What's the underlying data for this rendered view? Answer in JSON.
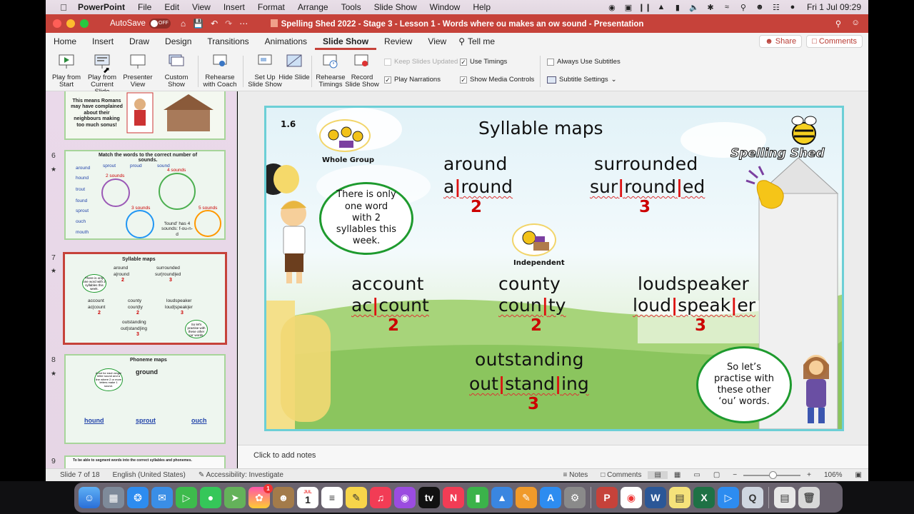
{
  "menubar": {
    "app": "PowerPoint",
    "items": [
      "File",
      "Edit",
      "View",
      "Insert",
      "Format",
      "Arrange",
      "Tools",
      "Slide Show",
      "Window",
      "Help"
    ],
    "clock": "Fri 1 Jul  09:29"
  },
  "titlebar": {
    "autosave_label": "AutoSave",
    "autosave_state": "OFF",
    "title": "Spelling Shed 2022 - Stage 3 - Lesson 1 - Words where ou makes an ow sound - Presentation"
  },
  "ribbon_tabs": {
    "tabs": [
      "Home",
      "Insert",
      "Draw",
      "Design",
      "Transitions",
      "Animations",
      "Slide Show",
      "Review",
      "View"
    ],
    "tell_me": "Tell me",
    "share": "Share",
    "comments": "Comments"
  },
  "ribbon": {
    "play_from_start": "Play from Start",
    "play_from_current": "Play from Current Slide",
    "presenter_view": "Presenter View",
    "custom_show": "Custom Show",
    "rehearse_coach": "Rehearse with Coach",
    "set_up": "Set Up Slide Show",
    "hide_slide": "Hide Slide",
    "rehearse_timings": "Rehearse Timings",
    "record": "Record Slide Show",
    "keep_updated": "Keep Slides Updated",
    "play_narrations": "Play Narrations",
    "use_timings": "Use Timings",
    "show_media": "Show Media Controls",
    "always_subtitles": "Always Use Subtitles",
    "subtitle_settings": "Subtitle Settings"
  },
  "thumbnails": {
    "top_partial_text": "This means Romans may have complained about their neighbours making too much sonus!",
    "slides": [
      {
        "num": "6",
        "title": "Match the words to the correct number of sounds.",
        "words": [
          "around",
          "sprout",
          "proud",
          "sound",
          "hound",
          "trout",
          "found",
          "sprout",
          "ouch",
          "mouth"
        ],
        "note": "'found' has 4 sounds: f-ou-n-d",
        "circles": [
          "2 sounds",
          "4 sounds",
          "3 sounds",
          "5 sounds"
        ]
      },
      {
        "num": "7",
        "title": "Syllable maps",
        "bubble": "There is only one word with 2 syllables this week.",
        "bubble2": "So let's practise with these other 'ou' words."
      },
      {
        "num": "8",
        "title": "Phoneme maps",
        "word_top": "ground",
        "words": [
          "hound",
          "sprout",
          "ouch"
        ],
        "bubble": "A dot for each single letter sound and a line where 2 or more letters make 1 sound."
      },
      {
        "num": "9",
        "title": "To be able to segment words into the correct syllables and phonemes."
      }
    ]
  },
  "slide": {
    "number": "1.6",
    "title": "Syllable maps",
    "brand": "Spelling Shed",
    "whole_group": "Whole Group",
    "independent": "Independent",
    "bubble_left": "There is only one word with 2 syllables this week.",
    "bubble_right": "So let’s practise with these other ‘ou’ words.",
    "words": [
      {
        "word": "around",
        "parts": [
          "a",
          "round"
        ],
        "count": "2"
      },
      {
        "word": "surrounded",
        "parts": [
          "sur",
          "round",
          "ed"
        ],
        "count": "3"
      },
      {
        "word": "account",
        "parts": [
          "ac",
          "count"
        ],
        "count": "2"
      },
      {
        "word": "county",
        "parts": [
          "coun",
          "ty"
        ],
        "count": "2"
      },
      {
        "word": "loudspeaker",
        "parts": [
          "loud",
          "speak",
          "er"
        ],
        "count": "3"
      },
      {
        "word": "outstanding",
        "parts": [
          "out",
          "stand",
          "ing"
        ],
        "count": "3"
      }
    ]
  },
  "notes_placeholder": "Click to add notes",
  "status": {
    "slide_of": "Slide 7 of 18",
    "language": "English (United States)",
    "accessibility": "Accessibility: Investigate",
    "notes": "Notes",
    "comments": "Comments",
    "zoom": "106%"
  },
  "dock": {
    "calendar_month": "JUL",
    "calendar_day": "1",
    "photos_badge": "1"
  }
}
